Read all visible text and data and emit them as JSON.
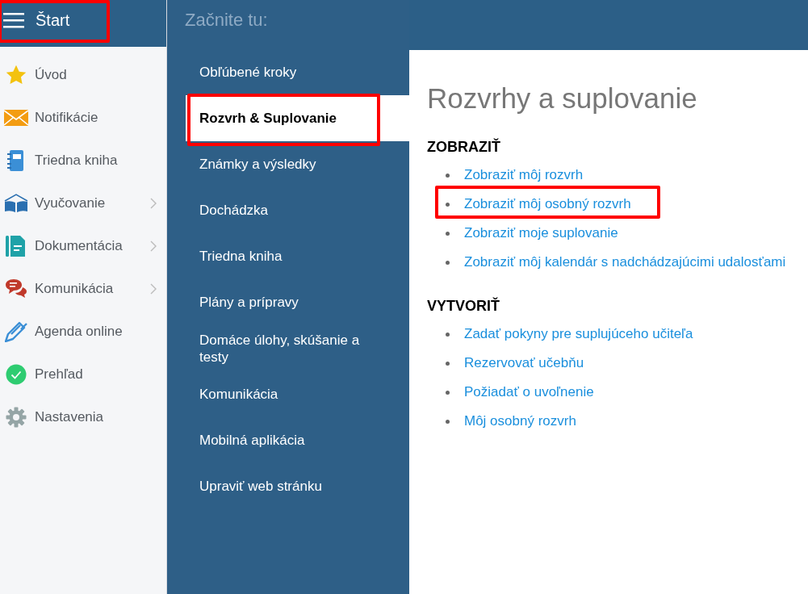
{
  "header": {
    "title": "Štart",
    "highlighted": true
  },
  "sidebar": {
    "items": [
      {
        "label": "Úvod",
        "has_submenu": false
      },
      {
        "label": "Notifikácie",
        "has_submenu": false
      },
      {
        "label": "Triedna kniha",
        "has_submenu": false
      },
      {
        "label": "Vyučovanie",
        "has_submenu": true
      },
      {
        "label": "Dokumentácia",
        "has_submenu": true
      },
      {
        "label": "Komunikácia",
        "has_submenu": true
      },
      {
        "label": "Agenda online",
        "has_submenu": false
      },
      {
        "label": "Prehľad",
        "has_submenu": false
      },
      {
        "label": "Nastavenia",
        "has_submenu": false
      }
    ]
  },
  "menu": {
    "heading": "Začnite tu:",
    "items": [
      {
        "label": "Obľúbené kroky",
        "selected": false,
        "highlighted": false
      },
      {
        "label": "Rozvrh & Suplovanie",
        "selected": true,
        "highlighted": true
      },
      {
        "label": "Známky a výsledky",
        "selected": false,
        "highlighted": false
      },
      {
        "label": "Dochádzka",
        "selected": false,
        "highlighted": false
      },
      {
        "label": "Triedna kniha",
        "selected": false,
        "highlighted": false
      },
      {
        "label": "Plány a prípravy",
        "selected": false,
        "highlighted": false
      },
      {
        "label": "Domáce úlohy, skúšanie a testy",
        "selected": false,
        "highlighted": false
      },
      {
        "label": "Komunikácia",
        "selected": false,
        "highlighted": false
      },
      {
        "label": "Mobilná aplikácia",
        "selected": false,
        "highlighted": false
      },
      {
        "label": "Upraviť web stránku",
        "selected": false,
        "highlighted": false
      }
    ]
  },
  "content": {
    "title": "Rozvrhy a suplovanie",
    "sections": [
      {
        "heading": "ZOBRAZIŤ",
        "links": [
          {
            "label": "Zobraziť môj rozvrh",
            "highlighted": false
          },
          {
            "label": "Zobraziť môj osobný rozvrh",
            "highlighted": true
          },
          {
            "label": "Zobraziť moje suplovanie",
            "highlighted": false
          },
          {
            "label": "Zobraziť môj kalendár s nadchádzajúcimi udalosťami",
            "highlighted": false
          }
        ]
      },
      {
        "heading": "VYTVORIŤ",
        "links": [
          {
            "label": "Zadať pokyny pre suplujúceho učiteľa",
            "highlighted": false
          },
          {
            "label": "Rezervovať učebňu",
            "highlighted": false
          },
          {
            "label": "Požiadať o uvoľnenie",
            "highlighted": false
          },
          {
            "label": "Môj osobný rozvrh",
            "highlighted": false
          }
        ]
      }
    ]
  }
}
